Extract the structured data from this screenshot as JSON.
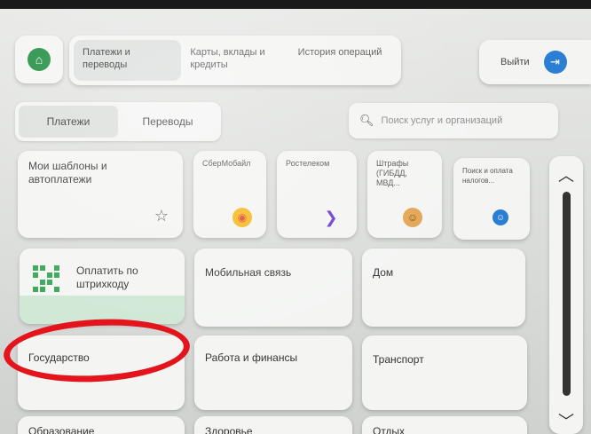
{
  "nav": {
    "tabs": [
      {
        "label": "Платежи и переводы"
      },
      {
        "label": "Карты, вклады и кредиты"
      },
      {
        "label": "История операций"
      }
    ],
    "logout_label": "Выйти"
  },
  "segmented": {
    "items": [
      {
        "label": "Платежи"
      },
      {
        "label": "Переводы"
      }
    ]
  },
  "search": {
    "placeholder": "Поиск услуг и организаций"
  },
  "tiles": {
    "templates": "Мои шаблоны и автоплатежи",
    "sbermobile": "СберМобайл",
    "rostelecom": "Ростелеком",
    "fines": "Штрафы (ГИБДД, МВД...",
    "tax_search": "Поиск и оплата налогов...",
    "barcode": "Оплатить по штрихкоду",
    "mobile": "Мобильная связь",
    "home": "Дом",
    "government": "Государство",
    "work_finance": "Работа и финансы",
    "transport": "Транспорт",
    "education": "Образование",
    "health": "Здоровье",
    "leisure": "Отдых"
  },
  "colors": {
    "brand_green": "#1c8a3d",
    "accent_blue": "#2a7fd4",
    "highlight_red": "#e3141b"
  },
  "icons": {
    "home": "home-icon",
    "logout": "logout-icon",
    "search": "search-icon",
    "star": "star-icon",
    "qr": "qr-code-icon"
  }
}
